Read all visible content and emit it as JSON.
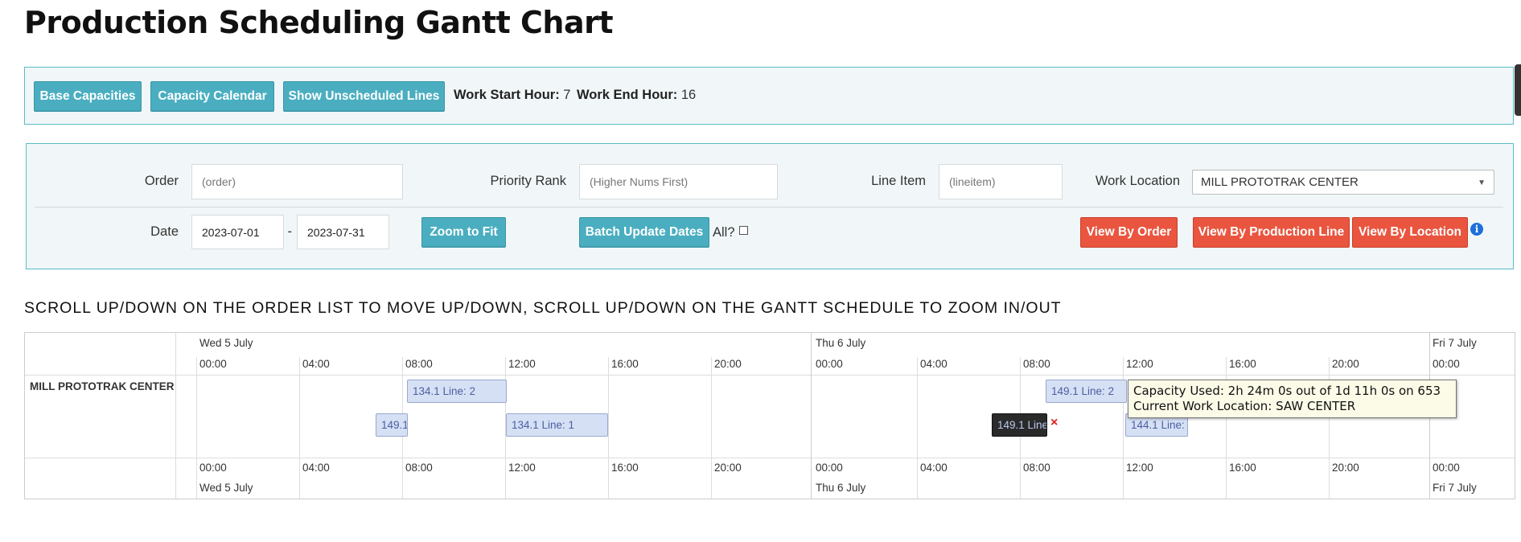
{
  "page": {
    "title": "Production Scheduling Gantt Chart"
  },
  "toolbar": {
    "base_capacities": "Base Capacities",
    "capacity_calendar": "Capacity Calendar",
    "show_unscheduled": "Show Unscheduled Lines",
    "work_start_label": "Work Start Hour:",
    "work_start_value": "7",
    "work_end_label": "Work End Hour:",
    "work_end_value": "16"
  },
  "filters": {
    "order_label": "Order",
    "order_placeholder": "(order)",
    "priority_label": "Priority Rank",
    "priority_placeholder": "(Higher Nums First)",
    "line_item_label": "Line Item",
    "line_item_placeholder": "(lineitem)",
    "work_location_label": "Work Location",
    "work_location_value": "MILL PROTOTRAK CENTER",
    "date_label": "Date",
    "date_from": "2023-07-01",
    "date_separator": "-",
    "date_to": "2023-07-31",
    "zoom_to_fit": "Zoom to Fit",
    "batch_update": "Batch Update Dates",
    "all_label": "All?",
    "view_by_order": "View By Order",
    "view_by_line": "View By Production Line",
    "view_by_location": "View By Location",
    "info_icon": "info-icon"
  },
  "instructions": "SCROLL UP/DOWN ON THE ORDER LIST TO MOVE UP/DOWN, SCROLL UP/DOWN ON THE GANTT SCHEDULE TO ZOOM IN/OUT",
  "gantt": {
    "resource": "MILL PROTOTRAK CENTER",
    "days": [
      "Wed 5 July",
      "Thu 6 July",
      "Fri 7 July"
    ],
    "hours": [
      "00:00",
      "04:00",
      "08:00",
      "12:00",
      "16:00",
      "20:00",
      "00:00",
      "04:00",
      "08:00",
      "12:00",
      "16:00",
      "20:00",
      "00:00"
    ],
    "bars": {
      "b1": "134.1 Line: 2",
      "b2": "149.1",
      "b3": "134.1 Line: 1",
      "b4": "149.1 Line: 2",
      "b5": "149.1 Line",
      "b6": "144.1 Line:"
    },
    "remove_icon": "×",
    "tooltip": {
      "line1": "Capacity Used: 2h 24m 0s out of 1d 11h 0s on 653",
      "line2": "Current Work Location: SAW CENTER"
    }
  },
  "colors": {
    "info_button": "#4aaec0",
    "danger_button": "#e9553f",
    "panel_border": "#5bbcc9",
    "bar_fill": "#d6e0f5"
  }
}
